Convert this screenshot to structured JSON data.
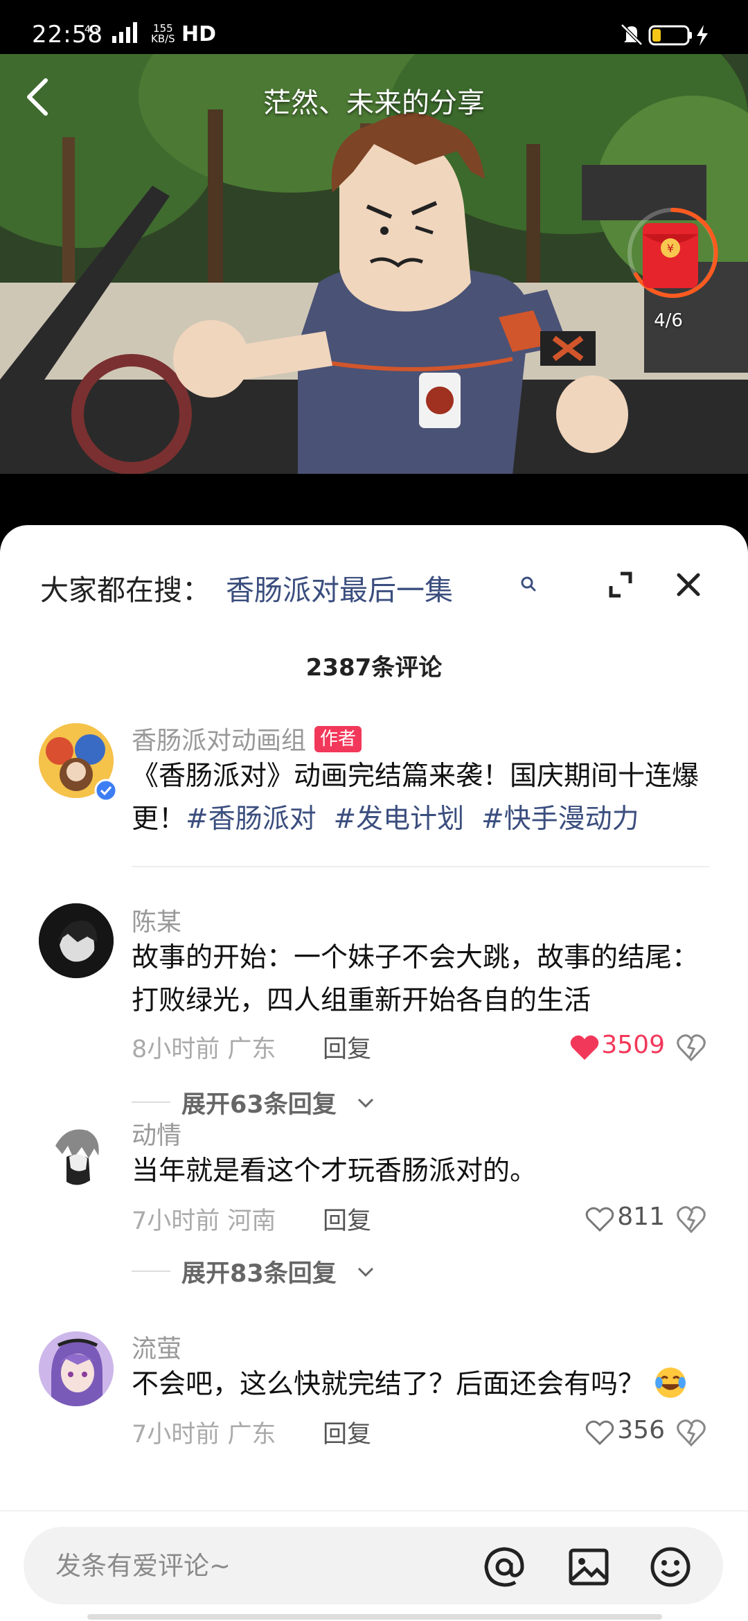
{
  "status_bar": {
    "time": "22:58",
    "network": "4G",
    "speed_value": "155",
    "speed_unit": "KB/S",
    "hd": "HD",
    "icons": [
      "signal-icon",
      "mute-icon",
      "battery-icon",
      "charging-icon"
    ]
  },
  "video": {
    "title": "茫然、未来的分享",
    "red_packet_count": "4/6",
    "red_packet_icon": "red-envelope-icon"
  },
  "sheet": {
    "search_label": "大家都在搜：",
    "search_term": "香肠派对最后一集",
    "comment_count": "2387条评论"
  },
  "comments": [
    {
      "name": "香肠派对动画组",
      "badge": "作者",
      "text": "《香肠派对》动画完结篇来袭！国庆期间十连爆更！",
      "tags": [
        "#香肠派对",
        "#发电计划",
        "#快手漫动力"
      ]
    },
    {
      "name": "陈某",
      "text": "故事的开始：一个妹子不会大跳，故事的结尾：打败绿光，四人组重新开始各自的生活",
      "time": "8小时前",
      "location": "广东",
      "reply_label": "回复",
      "likes": "3509",
      "liked": true,
      "expand_label": "展开63条回复"
    },
    {
      "name": "动情",
      "text": "当年就是看这个才玩香肠派对的。",
      "time": "7小时前",
      "location": "河南",
      "reply_label": "回复",
      "likes": "811",
      "liked": false,
      "expand_label": "展开83条回复"
    },
    {
      "name": "流萤",
      "text": "不会吧，这么快就完结了？后面还会有吗？",
      "emoji": "laughing-crying-emoji",
      "time": "7小时前",
      "location": "广东",
      "reply_label": "回复",
      "likes": "356",
      "liked": false
    }
  ],
  "input": {
    "placeholder": "发条有爱评论~"
  },
  "colors": {
    "accent_red": "#f2385a",
    "tag_blue": "#3b4e7e",
    "red_packet_ring": "#ff5a1f"
  }
}
